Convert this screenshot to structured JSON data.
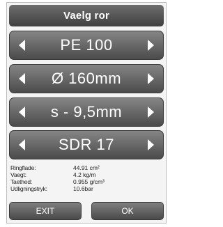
{
  "title": "Vaelg ror",
  "selectors": [
    {
      "name": "material",
      "value": "PE 100"
    },
    {
      "name": "diameter",
      "value": "Ø 160mm"
    },
    {
      "name": "wall-thickness",
      "value": "s - 9,5mm"
    },
    {
      "name": "sdr",
      "value": "SDR 17"
    }
  ],
  "icons": {
    "left": "arrow-left-icon",
    "right": "arrow-right-icon"
  },
  "info": [
    {
      "label": "Ringflade:",
      "value": "44.91 cm²"
    },
    {
      "label": "Vaegt:",
      "value": "4.2 kg/m"
    },
    {
      "label": "Taethed:",
      "value": "0.955 g/cm³"
    },
    {
      "label": "Udligningstryk:",
      "value": "10.6bar"
    }
  ],
  "buttons": {
    "exit": "EXIT",
    "ok": "OK"
  },
  "colors": {
    "panel": "#4b4b4b",
    "text_on_panel": "#ffffff",
    "background": "#f4f4f4"
  }
}
